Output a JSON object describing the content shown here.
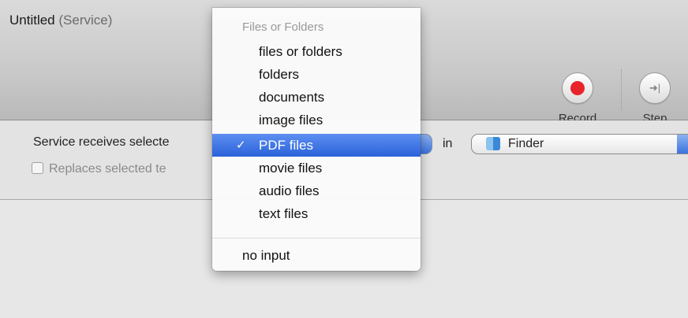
{
  "window": {
    "title": "Untitled",
    "title_suffix": "(Service)"
  },
  "toolbar": {
    "record_label": "Record",
    "step_label": "Step"
  },
  "service": {
    "receives_label": "Service receives selecte",
    "replaces_label": "Replaces selected te",
    "in_label": "in",
    "application": "Finder"
  },
  "menu": {
    "header": "Files or Folders",
    "items": [
      {
        "label": "files or folders",
        "selected": false
      },
      {
        "label": "folders",
        "selected": false
      },
      {
        "label": "documents",
        "selected": false
      },
      {
        "label": "image files",
        "selected": false
      },
      {
        "label": "PDF files",
        "selected": true
      },
      {
        "label": "movie files",
        "selected": false
      },
      {
        "label": "audio files",
        "selected": false
      },
      {
        "label": "text files",
        "selected": false
      }
    ],
    "checkmark": "✓",
    "extra_item": "no input"
  },
  "colors": {
    "selection": "#3a70e0",
    "record": "#e8242a"
  }
}
